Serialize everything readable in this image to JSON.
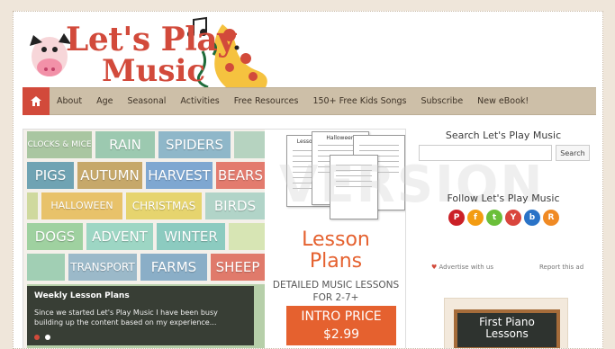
{
  "site": {
    "logo_line1": "Let's Play",
    "logo_line2": "Music"
  },
  "nav": {
    "home_icon": "home-icon",
    "items": [
      "About",
      "Age",
      "Seasonal",
      "Activities",
      "Free Resources",
      "150+ Free Kids Songs",
      "Subscribe",
      "New eBook!"
    ]
  },
  "slider": {
    "tiles": [
      "CLOCKS & MICE",
      "RAIN",
      "SPIDERS",
      "PIGS",
      "AUTUMN",
      "HARVEST",
      "BEARS",
      "HALLOWEEN",
      "CHRISTMAS",
      "BIRDS",
      "DOGS",
      "ADVENT",
      "WINTER",
      "TRANSPORT",
      "FARMS",
      "SHEEP"
    ],
    "lesson_title1": "Lesson",
    "lesson_title2": "Plans",
    "lesson_sub1": "DETAILED MUSIC LESSONS",
    "lesson_sub2": "FOR 2-7+",
    "intro_line1": "INTRO PRICE",
    "intro_line2": "$2.99",
    "caption_title": "Weekly Lesson Plans",
    "caption_desc": "Since we started Let's Play Music I have been busy building up the content based on my experience...",
    "paper_title": "Lesson Plans",
    "paper_title2": "Halloween"
  },
  "sidebar": {
    "search_title": "Search Let's Play Music",
    "search_placeholder": "",
    "search_button": "Search",
    "follow_title": "Follow Let's Play Music",
    "socials": [
      {
        "name": "pinterest-icon",
        "glyph": "P",
        "color": "#cb2027"
      },
      {
        "name": "facebook-icon",
        "glyph": "f",
        "color": "#f39c12"
      },
      {
        "name": "twitter-icon",
        "glyph": "t",
        "color": "#6bbf3a"
      },
      {
        "name": "youtube-icon",
        "glyph": "Y",
        "color": "#d9453d"
      },
      {
        "name": "bloglovin-icon",
        "glyph": "b",
        "color": "#2a73c7"
      },
      {
        "name": "rss-icon",
        "glyph": "R",
        "color": "#f08a24"
      }
    ],
    "advertise": "Advertise with us",
    "report": "Report this ad",
    "book_title1": "First Piano",
    "book_title2": "Lessons"
  },
  "watermark": "VERSION"
}
